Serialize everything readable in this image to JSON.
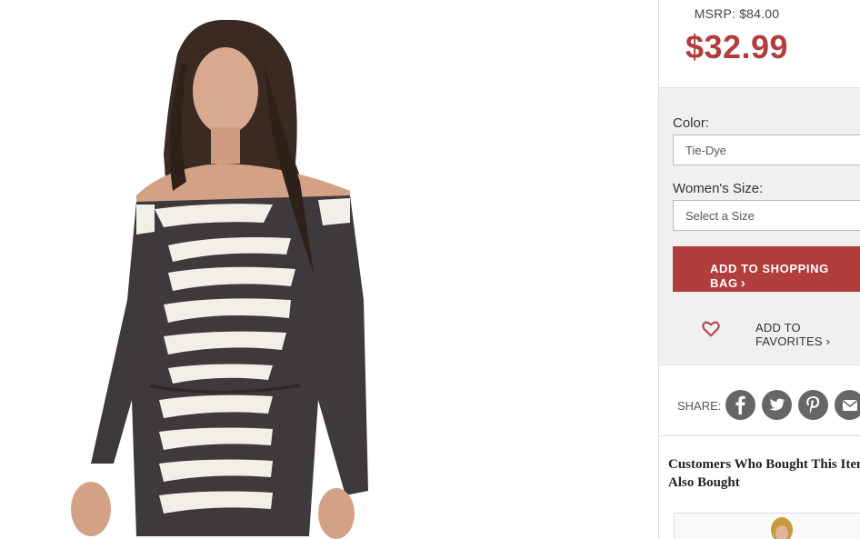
{
  "price": {
    "msrp": "MSRP: $84.00",
    "sale": "$32.99"
  },
  "options": {
    "color_label": "Color:",
    "color_value": "Tie-Dye",
    "size_label": "Women's Size:",
    "size_placeholder": "Select a Size"
  },
  "actions": {
    "add_to_bag": "ADD TO SHOPPING BAG",
    "add_to_bag_chevron": "›",
    "add_to_favorites": "ADD TO FAVORITES ›"
  },
  "share": {
    "label": "SHARE:",
    "icons": [
      "facebook-icon",
      "twitter-icon",
      "pinterest-icon",
      "email-icon"
    ]
  },
  "also_bought": {
    "title": "Customers Who Bought This Item Also Bought"
  },
  "colors": {
    "accent": "#b13d3d",
    "panel_bg": "#f0f0f0",
    "social_icon_bg": "#666666"
  }
}
